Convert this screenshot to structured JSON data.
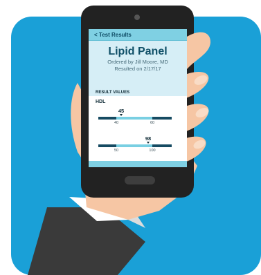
{
  "nav": {
    "back_label": "< Test Results"
  },
  "panel": {
    "title": "Lipid Panel",
    "ordered_by": "Ordered by Jill Moore, MD",
    "resulted_on": "Resulted on 2/17/17"
  },
  "results": {
    "section_label": "RESULT VALUES",
    "items": [
      {
        "name": "HDL",
        "value": "45",
        "low_label": "40",
        "high_label": "60",
        "value_fraction": 0.33
      },
      {
        "name": "",
        "value": "98",
        "low_label": "50",
        "high_label": "100",
        "value_fraction": 0.96
      }
    ]
  },
  "colors": {
    "background_tile": "#1aa0d7",
    "phone_body": "#222222",
    "screen_bg": "#d6eef6",
    "nav_bar": "#7fd0e3",
    "range_dark": "#164b62",
    "range_light": "#79cfe2",
    "title_text": "#0f4f67"
  }
}
